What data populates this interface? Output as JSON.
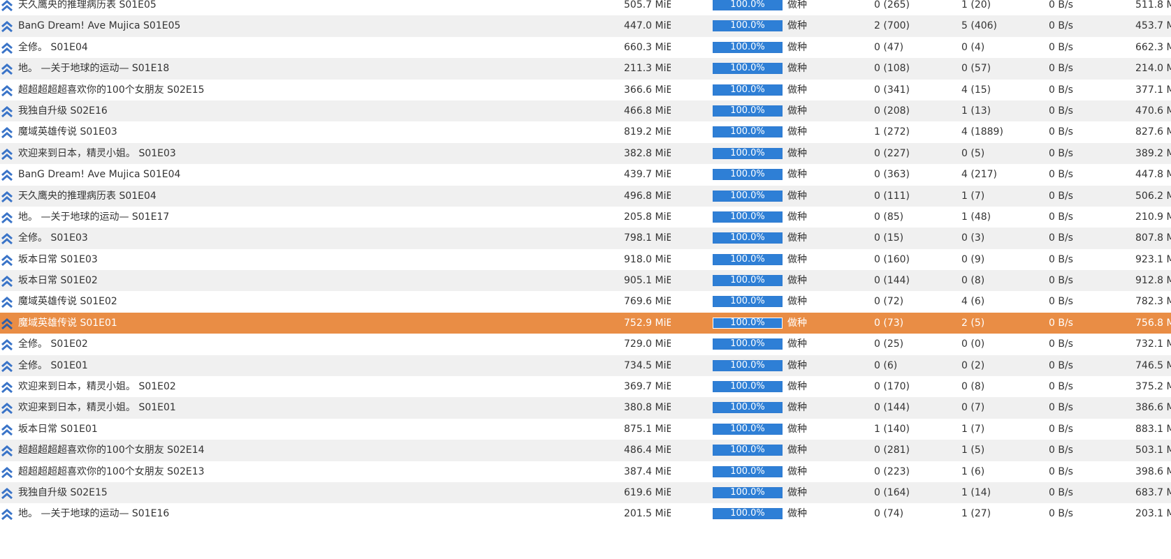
{
  "colors": {
    "row_even_bg": "#f0f0f0",
    "row_odd_bg": "#ffffff",
    "selected_row_bg": "#e98d45",
    "progress_fill": "#2e7fd6",
    "status_icon": "#3a74c8"
  },
  "rows": [
    {
      "name": "天久鹰央的推理病历表 S01E05",
      "size": "505.7 MiB",
      "progress": "100.0%",
      "status": "做种",
      "seeds": "0 (265)",
      "peers": "1 (20)",
      "dl_speed": "0 B/s",
      "uploaded": "511.8 M",
      "icon": "seeding-arrows-icon"
    },
    {
      "name": "BanG Dream! Ave Mujica S01E05",
      "size": "447.0 MiB",
      "progress": "100.0%",
      "status": "做种",
      "seeds": "2 (700)",
      "peers": "5 (406)",
      "dl_speed": "0 B/s",
      "uploaded": "453.7 M",
      "icon": "seeding-arrows-icon"
    },
    {
      "name": "全修。 S01E04",
      "size": "660.3 MiB",
      "progress": "100.0%",
      "status": "做种",
      "seeds": "0 (47)",
      "peers": "0 (4)",
      "dl_speed": "0 B/s",
      "uploaded": "662.3 M",
      "icon": "seeding-arrows-icon"
    },
    {
      "name": "地。 —关于地球的运动— S01E18",
      "size": "211.3 MiB",
      "progress": "100.0%",
      "status": "做种",
      "seeds": "0 (108)",
      "peers": "0 (57)",
      "dl_speed": "0 B/s",
      "uploaded": "214.0 M",
      "icon": "seeding-arrows-icon"
    },
    {
      "name": "超超超超超喜欢你的100个女朋友 S02E15",
      "size": "366.6 MiB",
      "progress": "100.0%",
      "status": "做种",
      "seeds": "0 (341)",
      "peers": "4 (15)",
      "dl_speed": "0 B/s",
      "uploaded": "377.1 M",
      "icon": "seeding-arrows-icon"
    },
    {
      "name": "我独自升级 S02E16",
      "size": "466.8 MiB",
      "progress": "100.0%",
      "status": "做种",
      "seeds": "0 (208)",
      "peers": "1 (13)",
      "dl_speed": "0 B/s",
      "uploaded": "470.6 M",
      "icon": "seeding-arrows-icon"
    },
    {
      "name": "魔域英雄传说 S01E03",
      "size": "819.2 MiB",
      "progress": "100.0%",
      "status": "做种",
      "seeds": "1 (272)",
      "peers": "4 (1889)",
      "dl_speed": "0 B/s",
      "uploaded": "827.6 M",
      "icon": "seeding-arrows-icon"
    },
    {
      "name": "欢迎来到日本，精灵小姐。 S01E03",
      "size": "382.8 MiB",
      "progress": "100.0%",
      "status": "做种",
      "seeds": "0 (227)",
      "peers": "0 (5)",
      "dl_speed": "0 B/s",
      "uploaded": "389.2 M",
      "icon": "seeding-arrows-icon"
    },
    {
      "name": "BanG Dream! Ave Mujica S01E04",
      "size": "439.7 MiB",
      "progress": "100.0%",
      "status": "做种",
      "seeds": "0 (363)",
      "peers": "4 (217)",
      "dl_speed": "0 B/s",
      "uploaded": "447.8 M",
      "icon": "seeding-arrows-icon"
    },
    {
      "name": "天久鹰央的推理病历表 S01E04",
      "size": "496.8 MiB",
      "progress": "100.0%",
      "status": "做种",
      "seeds": "0 (111)",
      "peers": "1 (7)",
      "dl_speed": "0 B/s",
      "uploaded": "506.2 M",
      "icon": "seeding-arrows-icon"
    },
    {
      "name": "地。 —关于地球的运动— S01E17",
      "size": "205.8 MiB",
      "progress": "100.0%",
      "status": "做种",
      "seeds": "0 (85)",
      "peers": "1 (48)",
      "dl_speed": "0 B/s",
      "uploaded": "210.9 M",
      "icon": "seeding-arrows-icon"
    },
    {
      "name": "全修。 S01E03",
      "size": "798.1 MiB",
      "progress": "100.0%",
      "status": "做种",
      "seeds": "0 (15)",
      "peers": "0 (3)",
      "dl_speed": "0 B/s",
      "uploaded": "807.8 M",
      "icon": "seeding-arrows-icon"
    },
    {
      "name": "坂本日常 S01E03",
      "size": "918.0 MiB",
      "progress": "100.0%",
      "status": "做种",
      "seeds": "0 (160)",
      "peers": "0 (9)",
      "dl_speed": "0 B/s",
      "uploaded": "923.1 M",
      "icon": "seeding-arrows-icon"
    },
    {
      "name": "坂本日常 S01E02",
      "size": "905.1 MiB",
      "progress": "100.0%",
      "status": "做种",
      "seeds": "0 (144)",
      "peers": "0 (8)",
      "dl_speed": "0 B/s",
      "uploaded": "912.8 M",
      "icon": "seeding-arrows-icon"
    },
    {
      "name": "魔域英雄传说 S01E02",
      "size": "769.6 MiB",
      "progress": "100.0%",
      "status": "做种",
      "seeds": "0 (72)",
      "peers": "4 (6)",
      "dl_speed": "0 B/s",
      "uploaded": "782.3 M",
      "icon": "seeding-arrows-icon"
    },
    {
      "name": "魔域英雄传说 S01E01",
      "size": "752.9 MiB",
      "progress": "100.0%",
      "status": "做种",
      "seeds": "0 (73)",
      "peers": "2 (5)",
      "dl_speed": "0 B/s",
      "uploaded": "756.8 M",
      "icon": "seeding-arrows-icon",
      "selected": true
    },
    {
      "name": "全修。 S01E02",
      "size": "729.0 MiB",
      "progress": "100.0%",
      "status": "做种",
      "seeds": "0 (25)",
      "peers": "0 (0)",
      "dl_speed": "0 B/s",
      "uploaded": "732.1 M",
      "icon": "seeding-arrows-icon"
    },
    {
      "name": "全修。 S01E01",
      "size": "734.5 MiB",
      "progress": "100.0%",
      "status": "做种",
      "seeds": "0 (6)",
      "peers": "0 (2)",
      "dl_speed": "0 B/s",
      "uploaded": "746.5 M",
      "icon": "seeding-arrows-icon"
    },
    {
      "name": "欢迎来到日本，精灵小姐。 S01E02",
      "size": "369.7 MiB",
      "progress": "100.0%",
      "status": "做种",
      "seeds": "0 (170)",
      "peers": "0 (8)",
      "dl_speed": "0 B/s",
      "uploaded": "375.2 M",
      "icon": "seeding-arrows-icon"
    },
    {
      "name": "欢迎来到日本，精灵小姐。 S01E01",
      "size": "380.8 MiB",
      "progress": "100.0%",
      "status": "做种",
      "seeds": "0 (144)",
      "peers": "0 (7)",
      "dl_speed": "0 B/s",
      "uploaded": "386.6 M",
      "icon": "seeding-arrows-icon"
    },
    {
      "name": "坂本日常 S01E01",
      "size": "875.1 MiB",
      "progress": "100.0%",
      "status": "做种",
      "seeds": "1 (140)",
      "peers": "1 (7)",
      "dl_speed": "0 B/s",
      "uploaded": "883.1 M",
      "icon": "seeding-arrows-icon"
    },
    {
      "name": "超超超超超喜欢你的100个女朋友 S02E14",
      "size": "486.4 MiB",
      "progress": "100.0%",
      "status": "做种",
      "seeds": "0 (281)",
      "peers": "1 (5)",
      "dl_speed": "0 B/s",
      "uploaded": "503.1 M",
      "icon": "seeding-arrows-icon"
    },
    {
      "name": "超超超超超喜欢你的100个女朋友 S02E13",
      "size": "387.4 MiB",
      "progress": "100.0%",
      "status": "做种",
      "seeds": "0 (223)",
      "peers": "1 (6)",
      "dl_speed": "0 B/s",
      "uploaded": "398.6 M",
      "icon": "seeding-arrows-icon"
    },
    {
      "name": "我独自升级 S02E15",
      "size": "619.6 MiB",
      "progress": "100.0%",
      "status": "做种",
      "seeds": "0 (164)",
      "peers": "1 (14)",
      "dl_speed": "0 B/s",
      "uploaded": "683.7 M",
      "icon": "seeding-arrows-icon"
    },
    {
      "name": "地。 —关于地球的运动— S01E16",
      "size": "201.5 MiB",
      "progress": "100.0%",
      "status": "做种",
      "seeds": "0 (74)",
      "peers": "1 (27)",
      "dl_speed": "0 B/s",
      "uploaded": "203.1 M",
      "icon": "seeding-arrows-icon"
    }
  ]
}
